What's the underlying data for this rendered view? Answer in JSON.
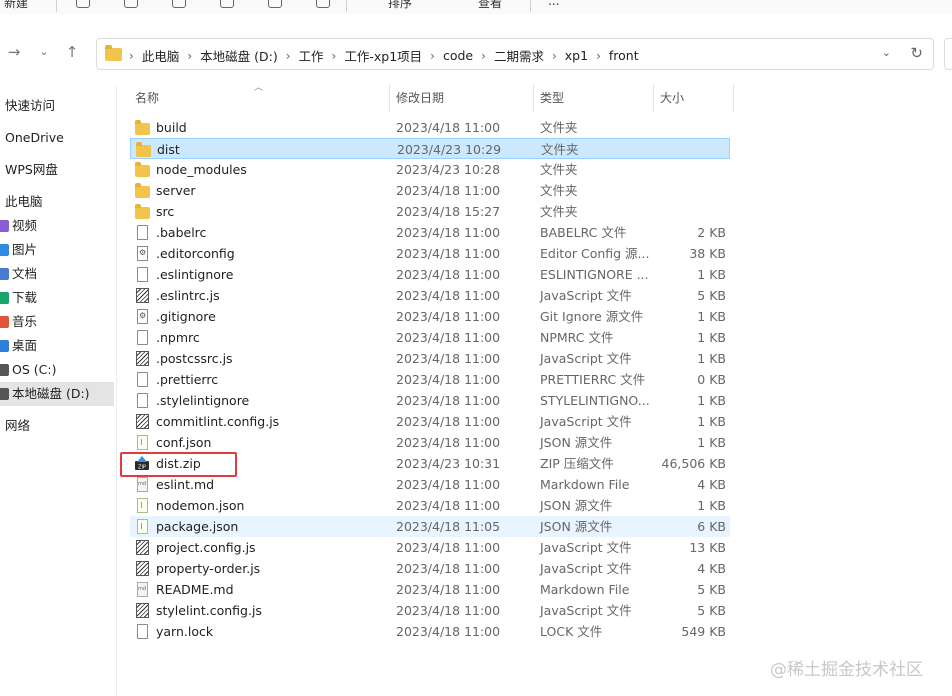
{
  "toolbar": {
    "new_label": "新建",
    "sort_label": "排序",
    "view_label": "查看",
    "more_label": "..."
  },
  "address": {
    "crumbs": [
      "此电脑",
      "本地磁盘 (D:)",
      "工作",
      "工作-xp1项目",
      "code",
      "二期需求",
      "xp1",
      "front"
    ],
    "separator": "›"
  },
  "nav": {
    "back_icon": "arrow-left-icon",
    "forward_icon": "arrow-right-icon",
    "recent_icon": "chevron-down-icon",
    "up_icon": "arrow-up-icon"
  },
  "sidebar": {
    "items": [
      {
        "label": "快速访问"
      },
      {
        "label": "OneDrive"
      },
      {
        "label": "WPS网盘"
      },
      {
        "label": "此电脑"
      },
      {
        "label": "视频",
        "color": "#8a5cd6"
      },
      {
        "label": "图片",
        "color": "#2d8be0"
      },
      {
        "label": "文档",
        "color": "#4a7bd0"
      },
      {
        "label": "下载",
        "color": "#1aa36a"
      },
      {
        "label": "音乐",
        "color": "#e0553a"
      },
      {
        "label": "桌面",
        "color": "#2f7ed8"
      },
      {
        "label": "OS (C:)",
        "color": "#555555"
      },
      {
        "label": "本地磁盘 (D:)",
        "color": "#555555"
      },
      {
        "label": "网络"
      }
    ]
  },
  "columns": {
    "name": "名称",
    "date": "修改日期",
    "type": "类型",
    "size": "大小"
  },
  "files": [
    {
      "name": "build",
      "date": "2023/4/18 11:00",
      "type": "文件夹",
      "size": "",
      "icon": "folder-icon"
    },
    {
      "name": "dist",
      "date": "2023/4/23 10:29",
      "type": "文件夹",
      "size": "",
      "icon": "folder-icon"
    },
    {
      "name": "node_modules",
      "date": "2023/4/23 10:28",
      "type": "文件夹",
      "size": "",
      "icon": "folder-icon"
    },
    {
      "name": "server",
      "date": "2023/4/18 11:00",
      "type": "文件夹",
      "size": "",
      "icon": "folder-icon"
    },
    {
      "name": "src",
      "date": "2023/4/18 15:27",
      "type": "文件夹",
      "size": "",
      "icon": "folder-icon"
    },
    {
      "name": ".babelrc",
      "date": "2023/4/18 11:00",
      "type": "BABELRC 文件",
      "size": "2 KB",
      "icon": "file-icon"
    },
    {
      "name": ".editorconfig",
      "date": "2023/4/18 11:00",
      "type": "Editor Config 源...",
      "size": "38 KB",
      "icon": "config-file-icon"
    },
    {
      "name": ".eslintignore",
      "date": "2023/4/18 11:00",
      "type": "ESLINTIGNORE ...",
      "size": "1 KB",
      "icon": "file-icon"
    },
    {
      "name": ".eslintrc.js",
      "date": "2023/4/18 11:00",
      "type": "JavaScript 文件",
      "size": "5 KB",
      "icon": "javascript-file-icon"
    },
    {
      "name": ".gitignore",
      "date": "2023/4/18 11:00",
      "type": "Git Ignore 源文件",
      "size": "1 KB",
      "icon": "config-file-icon"
    },
    {
      "name": ".npmrc",
      "date": "2023/4/18 11:00",
      "type": "NPMRC 文件",
      "size": "1 KB",
      "icon": "file-icon"
    },
    {
      "name": ".postcssrc.js",
      "date": "2023/4/18 11:00",
      "type": "JavaScript 文件",
      "size": "1 KB",
      "icon": "javascript-file-icon"
    },
    {
      "name": ".prettierrc",
      "date": "2023/4/18 11:00",
      "type": "PRETTIERRC 文件",
      "size": "0 KB",
      "icon": "file-icon"
    },
    {
      "name": ".stylelintignore",
      "date": "2023/4/18 11:00",
      "type": "STYLELINTIGNO...",
      "size": "1 KB",
      "icon": "file-icon"
    },
    {
      "name": "commitlint.config.js",
      "date": "2023/4/18 11:00",
      "type": "JavaScript 文件",
      "size": "1 KB",
      "icon": "javascript-file-icon"
    },
    {
      "name": "conf.json",
      "date": "2023/4/18 11:00",
      "type": "JSON 源文件",
      "size": "1 KB",
      "icon": "json-file-icon"
    },
    {
      "name": "dist.zip",
      "date": "2023/4/23 10:31",
      "type": "ZIP 压缩文件",
      "size": "46,506 KB",
      "icon": "zip-file-icon"
    },
    {
      "name": "eslint.md",
      "date": "2023/4/18 11:00",
      "type": "Markdown File",
      "size": "4 KB",
      "icon": "markdown-file-icon"
    },
    {
      "name": "nodemon.json",
      "date": "2023/4/18 11:00",
      "type": "JSON 源文件",
      "size": "1 KB",
      "icon": "json-file-icon"
    },
    {
      "name": "package.json",
      "date": "2023/4/18 11:05",
      "type": "JSON 源文件",
      "size": "6 KB",
      "icon": "json-file-icon"
    },
    {
      "name": "project.config.js",
      "date": "2023/4/18 11:00",
      "type": "JavaScript 文件",
      "size": "13 KB",
      "icon": "javascript-file-icon"
    },
    {
      "name": "property-order.js",
      "date": "2023/4/18 11:00",
      "type": "JavaScript 文件",
      "size": "4 KB",
      "icon": "javascript-file-icon"
    },
    {
      "name": "README.md",
      "date": "2023/4/18 11:00",
      "type": "Markdown File",
      "size": "5 KB",
      "icon": "markdown-file-icon"
    },
    {
      "name": "stylelint.config.js",
      "date": "2023/4/18 11:00",
      "type": "JavaScript 文件",
      "size": "5 KB",
      "icon": "javascript-file-icon"
    },
    {
      "name": "yarn.lock",
      "date": "2023/4/18 11:00",
      "type": "LOCK 文件",
      "size": "549 KB",
      "icon": "file-icon"
    }
  ],
  "selected_file": "dist",
  "hovered_file": "package.json",
  "highlighted_file": "dist.zip",
  "highlight_color": "#e23b3b",
  "selection_color": "#cce8ff",
  "watermark": "@稀土掘金技术社区"
}
